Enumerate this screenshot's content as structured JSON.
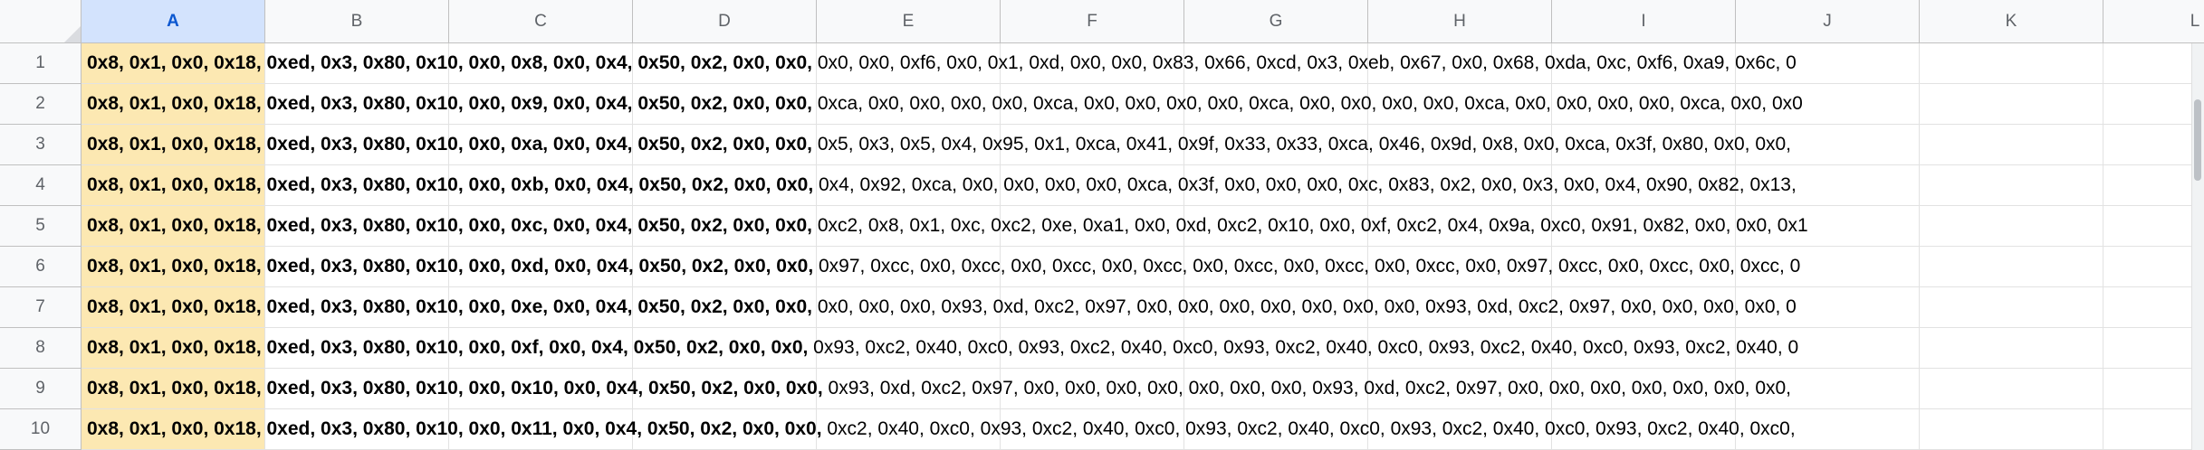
{
  "columns": [
    "A",
    "B",
    "C",
    "D",
    "E",
    "F",
    "G",
    "H",
    "I",
    "J",
    "K",
    "L"
  ],
  "selected_column": "A",
  "rows": [
    {
      "num": "1",
      "a_bold": "0x8, 0x1, 0x0, 0x18, 0xed, 0x3, 0x80, 0x10, 0x0, 0x8, 0x0, 0x4, 0x50, 0x2, 0x0, 0x0,",
      "a_rest": " 0x0, 0x0, 0xf6, 0x0, 0x1, 0xd, 0x0, 0x0, 0x83, 0x66, 0xcd, 0x3, 0xeb, 0x67, 0x0, 0x68, 0xda, 0xc, 0xf6, 0xa9, 0x6c, 0"
    },
    {
      "num": "2",
      "a_bold": "0x8, 0x1, 0x0, 0x18, 0xed, 0x3, 0x80, 0x10, 0x0, 0x9, 0x0, 0x4, 0x50, 0x2, 0x0, 0x0,",
      "a_rest": " 0xca, 0x0, 0x0, 0x0, 0x0, 0xca, 0x0, 0x0, 0x0, 0x0, 0xca, 0x0, 0x0, 0x0, 0x0, 0xca, 0x0, 0x0, 0x0, 0x0, 0xca, 0x0, 0x0"
    },
    {
      "num": "3",
      "a_bold": "0x8, 0x1, 0x0, 0x18, 0xed, 0x3, 0x80, 0x10, 0x0, 0xa, 0x0, 0x4, 0x50, 0x2, 0x0, 0x0,",
      "a_rest": " 0x5, 0x3, 0x5, 0x4, 0x95, 0x1, 0xca, 0x41, 0x9f, 0x33, 0x33, 0xca, 0x46, 0x9d, 0x8, 0x0, 0xca, 0x3f, 0x80, 0x0, 0x0,"
    },
    {
      "num": "4",
      "a_bold": "0x8, 0x1, 0x0, 0x18, 0xed, 0x3, 0x80, 0x10, 0x0, 0xb, 0x0, 0x4, 0x50, 0x2, 0x0, 0x0,",
      "a_rest": " 0x4, 0x92, 0xca, 0x0, 0x0, 0x0, 0x0, 0xca, 0x3f, 0x0, 0x0, 0x0, 0xc, 0x83, 0x2, 0x0, 0x3, 0x0, 0x4, 0x90, 0x82, 0x13,"
    },
    {
      "num": "5",
      "a_bold": "0x8, 0x1, 0x0, 0x18, 0xed, 0x3, 0x80, 0x10, 0x0, 0xc, 0x0, 0x4, 0x50, 0x2, 0x0, 0x0,",
      "a_rest": " 0xc2, 0x8, 0x1, 0xc, 0xc2, 0xe, 0xa1, 0x0, 0xd, 0xc2, 0x10, 0x0, 0xf, 0xc2, 0x4, 0x9a, 0xc0, 0x91, 0x82, 0x0, 0x0, 0x1"
    },
    {
      "num": "6",
      "a_bold": "0x8, 0x1, 0x0, 0x18, 0xed, 0x3, 0x80, 0x10, 0x0, 0xd, 0x0, 0x4, 0x50, 0x2, 0x0, 0x0,",
      "a_rest": " 0x97, 0xcc, 0x0, 0xcc, 0x0, 0xcc, 0x0, 0xcc, 0x0, 0xcc, 0x0, 0xcc, 0x0, 0xcc, 0x0, 0x97, 0xcc, 0x0, 0xcc, 0x0, 0xcc, 0"
    },
    {
      "num": "7",
      "a_bold": "0x8, 0x1, 0x0, 0x18, 0xed, 0x3, 0x80, 0x10, 0x0, 0xe, 0x0, 0x4, 0x50, 0x2, 0x0, 0x0,",
      "a_rest": " 0x0, 0x0, 0x0, 0x93, 0xd, 0xc2, 0x97, 0x0, 0x0, 0x0, 0x0, 0x0, 0x0, 0x0, 0x93, 0xd, 0xc2, 0x97, 0x0, 0x0, 0x0, 0x0, 0"
    },
    {
      "num": "8",
      "a_bold": "0x8, 0x1, 0x0, 0x18, 0xed, 0x3, 0x80, 0x10, 0x0, 0xf, 0x0, 0x4, 0x50, 0x2, 0x0, 0x0,",
      "a_rest": " 0x93, 0xc2, 0x40, 0xc0, 0x93, 0xc2, 0x40, 0xc0, 0x93, 0xc2, 0x40, 0xc0, 0x93, 0xc2, 0x40, 0xc0, 0x93, 0xc2, 0x40, 0"
    },
    {
      "num": "9",
      "a_bold": "0x8, 0x1, 0x0, 0x18, 0xed, 0x3, 0x80, 0x10, 0x0, 0x10, 0x0, 0x4, 0x50, 0x2, 0x0, 0x0,",
      "a_rest": " 0x93, 0xd, 0xc2, 0x97, 0x0, 0x0, 0x0, 0x0, 0x0, 0x0, 0x0, 0x93, 0xd, 0xc2, 0x97, 0x0, 0x0, 0x0, 0x0, 0x0, 0x0, 0x0,"
    },
    {
      "num": "10",
      "a_bold": "0x8, 0x1, 0x0, 0x18, 0xed, 0x3, 0x80, 0x10, 0x0, 0x11, 0x0, 0x4, 0x50, 0x2, 0x0, 0x0,",
      "a_rest": " 0xc2, 0x40, 0xc0, 0x93, 0xc2, 0x40, 0xc0, 0x93, 0xc2, 0x40, 0xc0, 0x93, 0xc2, 0x40, 0xc0, 0x93, 0xc2, 0x40, 0xc0,"
    }
  ]
}
